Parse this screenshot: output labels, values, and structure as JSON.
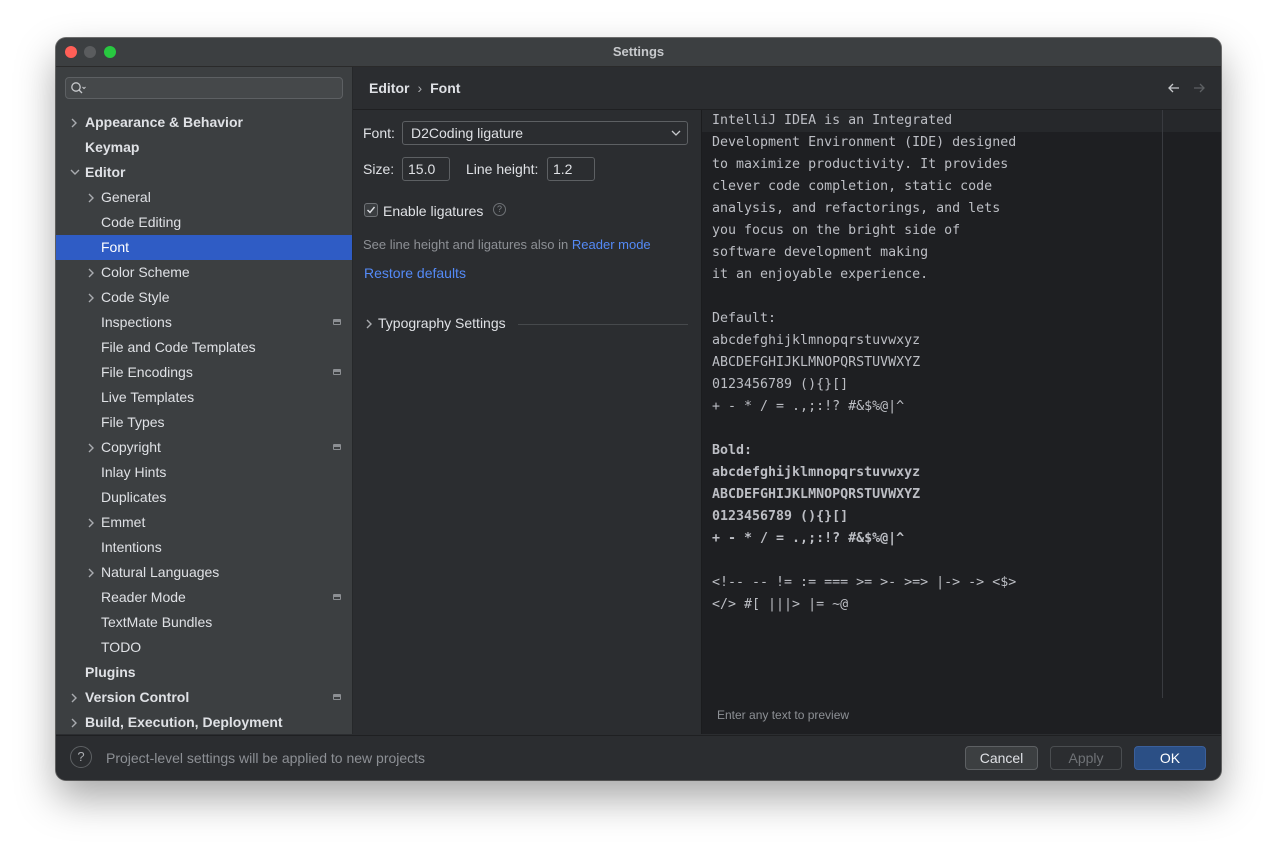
{
  "window": {
    "title": "Settings"
  },
  "sidebar": {
    "search_placeholder": "",
    "items": [
      {
        "label": "Appearance & Behavior"
      },
      {
        "label": "Keymap"
      },
      {
        "label": "Editor"
      },
      {
        "label": "General"
      },
      {
        "label": "Code Editing"
      },
      {
        "label": "Font"
      },
      {
        "label": "Color Scheme"
      },
      {
        "label": "Code Style"
      },
      {
        "label": "Inspections"
      },
      {
        "label": "File and Code Templates"
      },
      {
        "label": "File Encodings"
      },
      {
        "label": "Live Templates"
      },
      {
        "label": "File Types"
      },
      {
        "label": "Copyright"
      },
      {
        "label": "Inlay Hints"
      },
      {
        "label": "Duplicates"
      },
      {
        "label": "Emmet"
      },
      {
        "label": "Intentions"
      },
      {
        "label": "Natural Languages"
      },
      {
        "label": "Reader Mode"
      },
      {
        "label": "TextMate Bundles"
      },
      {
        "label": "TODO"
      },
      {
        "label": "Plugins"
      },
      {
        "label": "Version Control"
      },
      {
        "label": "Build, Execution, Deployment"
      }
    ]
  },
  "header": {
    "crumbs": [
      "Editor",
      "Font"
    ],
    "separator": "›"
  },
  "form": {
    "font_label": "Font:",
    "font_value": "D2Coding ligature",
    "size_label": "Size:",
    "size_value": "15.0",
    "line_height_label": "Line height:",
    "line_height_value": "1.2",
    "ligatures_label": "Enable ligatures",
    "ligatures_checked": true,
    "hint_text": "See line height and ligatures also in",
    "hint_link": "Reader mode",
    "restore_defaults": "Restore defaults",
    "typography_label": "Typography Settings"
  },
  "preview": {
    "lines": [
      "IntelliJ IDEA is an Integrated",
      "Development Environment (IDE) designed",
      "to maximize productivity. It provides",
      "clever code completion, static code",
      "analysis, and refactorings, and lets",
      "you focus on the bright side of",
      "software development making",
      "it an enjoyable experience.",
      "",
      "Default:",
      "abcdefghijklmnopqrstuvwxyz",
      "ABCDEFGHIJKLMNOPQRSTUVWXYZ",
      "0123456789 (){}[]",
      "+ - * / = .,;:!? #&$%@|^",
      "",
      "Bold:",
      "abcdefghijklmnopqrstuvwxyz",
      "ABCDEFGHIJKLMNOPQRSTUVWXYZ",
      "0123456789 (){}[]",
      "+ - * / = .,;:!? #&$%@|^",
      "",
      "<!-- -- != := === >= >- >=> |-> -> <$>",
      "</> #[ |||> |= ~@"
    ],
    "hint": "Enter any text to preview"
  },
  "footer": {
    "help": "?",
    "info": "Project-level settings will be applied to new projects",
    "cancel": "Cancel",
    "apply": "Apply",
    "ok": "OK"
  }
}
